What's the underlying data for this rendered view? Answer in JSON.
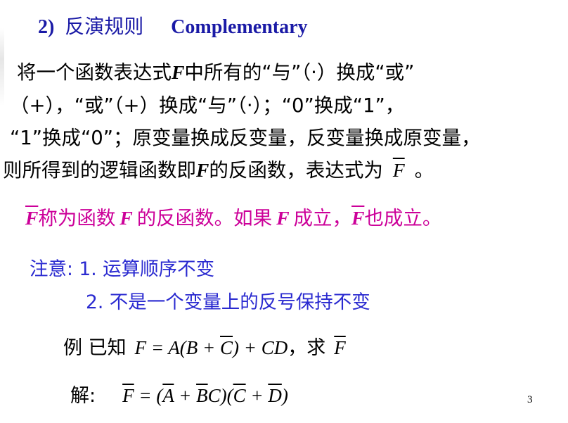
{
  "heading": {
    "number": "2)",
    "title_zh": "反演规则",
    "title_en": "Complementary"
  },
  "body": {
    "line1_pre": "将一个函数表达式",
    "line1_var": "F",
    "line1_post": "中所有的“与”（·）换成“或”",
    "line2": "（+），“或”（+）换成“与”（·）；“0”换成“1”，",
    "line3": "“1”换成“0”；原变量换成反变量，反变量换成原变量，",
    "line4_pre": "则所得到的逻辑函数即",
    "line4_var": "F",
    "line4_mid": "的反函数，表达式为",
    "line4_bar_var": "F",
    "line4_end": "。"
  },
  "statement": {
    "var_bar": "F",
    "text1": "称为函数",
    "var1": "F",
    "text2": "的反函数。如果",
    "var2": "F",
    "text3": "成立，",
    "var3_bar": "F",
    "text4": "也成立。"
  },
  "notes": {
    "label": "注意:",
    "item1": "1. 运算顺序不变",
    "item2": "2. 不是一个变量上的反号保持不变"
  },
  "example": {
    "label": "例 已知",
    "eq_lhs": "F = A(B + ",
    "eq_bar": "C",
    "eq_rhs": ") + CD",
    "sep": "，求",
    "target_bar": "F"
  },
  "solution": {
    "label": "解:",
    "lhs_bar": "F",
    "eq": " = (",
    "a_bar": "A",
    "plus1": " + ",
    "b_bar": "B",
    "c": "C)(",
    "c_bar": "C",
    "plus2": " + ",
    "d_bar": "D",
    "close": ")"
  },
  "page_number": "3"
}
